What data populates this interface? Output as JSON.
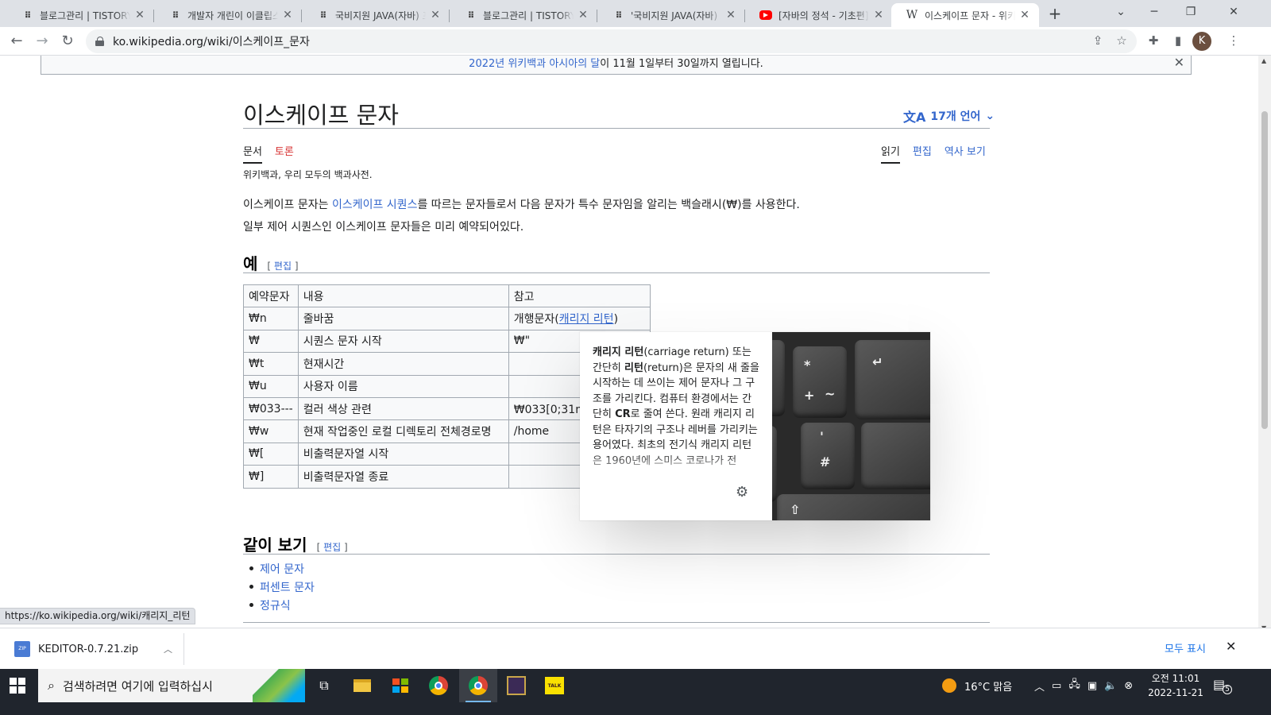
{
  "browser": {
    "tabs": [
      {
        "title": "블로그관리 | TISTORY",
        "favicon": "tistory-icon",
        "active": false
      },
      {
        "title": "개발자 개린이 이클립스",
        "favicon": "tistory-icon",
        "active": false
      },
      {
        "title": "국비지원 JAVA(자바) 프",
        "favicon": "tistory-icon",
        "active": false
      },
      {
        "title": "블로그관리 | TISTORY",
        "favicon": "tistory-icon",
        "active": false
      },
      {
        "title": "'국비지원 JAVA(자바) 프",
        "favicon": "tistory-icon",
        "active": false
      },
      {
        "title": "[자바의 정석 - 기초편]",
        "favicon": "youtube-icon",
        "active": false
      },
      {
        "title": "이스케이프 문자 - 위키",
        "favicon": "wikipedia-icon",
        "active": true
      }
    ],
    "url": "ko.wikipedia.org/wiki/이스케이프_문자",
    "profile_initial": "K",
    "status_url": "https://ko.wikipedia.org/wiki/캐리지_리턴"
  },
  "page": {
    "banner": {
      "link1": "2022년 위키백과 아시아의 달",
      "rest": "이 11월 1일부터 30일까지 열립니다."
    },
    "title": "이스케이프 문자",
    "languages": "17개 언어",
    "ns_tabs": {
      "article": "문서",
      "talk": "토론"
    },
    "view_tabs": {
      "read": "읽기",
      "edit": "편집",
      "history": "역사 보기"
    },
    "tagline": "위키백과, 우리 모두의 백과사전.",
    "intro": {
      "p1_a": "이스케이프 문자는 ",
      "p1_link": "이스케이프 시퀀스",
      "p1_b": "를 따르는 문자들로서 다음 문자가 특수 문자임을 알리는 백슬래시(₩)를 사용한다.",
      "p2": "일부 제어 시퀀스인 이스케이프 문자들은 미리 예약되어있다."
    },
    "section_examples": {
      "heading": "예",
      "edit_open": "[",
      "edit": "편집",
      "edit_close": "]"
    },
    "table": {
      "headers": [
        "예약문자",
        "내용",
        "참고"
      ],
      "rows": [
        [
          "₩n",
          "줄바꿈",
          "개행문자("
        ],
        [
          "₩",
          "시퀀스 문자 시작",
          "₩\""
        ],
        [
          "₩t",
          "현재시간",
          ""
        ],
        [
          "₩u",
          "사용자 이름",
          ""
        ],
        [
          "₩033---",
          "컬러 색상 관련",
          "₩033[0;31m 텍"
        ],
        [
          "₩w",
          "현재 작업중인 로컬 디렉토리 전체경로명",
          "/home"
        ],
        [
          "₩[",
          "비출력문자열 시작",
          ""
        ],
        [
          "₩]",
          "비출력문자열 종료",
          ""
        ]
      ],
      "row0_ref_link": "캐리지 리턴",
      "row0_ref_close": ")"
    },
    "section_seealso": {
      "heading": "같이 보기",
      "edit_open": "[",
      "edit": "편집",
      "edit_close": "]"
    },
    "seealso": [
      "제어 문자",
      "퍼센트 문자",
      "정규식"
    ],
    "popup": {
      "bold1": "캐리지 리턴",
      "t1": "(carriage return) 또는 간단히 ",
      "bold2": "리턴",
      "t2": "(return)은 문자의 새 줄을 시작하는 데 쓰이는 제어 문자나 그 구조를 가리킨다. 컴퓨터 환경에서는 간단히 ",
      "bold3": "CR",
      "t3": "로 줄여 쓴다. 원래 캐리지 리턴은 타자기의 구조나 레버를 가리키는 용어였다. 최초의 전기식 캐리지 리턴은 1960년에 스미스 코로나가 전"
    }
  },
  "download": {
    "file": "KEDITOR-0.7.21.zip",
    "show_all": "모두 표시"
  },
  "taskbar": {
    "search_placeholder": "검색하려면 여기에 입력하십시",
    "weather": "16°C 맑음",
    "time": "오전 11:01",
    "date": "2022-11-21",
    "notif_count": "5"
  }
}
